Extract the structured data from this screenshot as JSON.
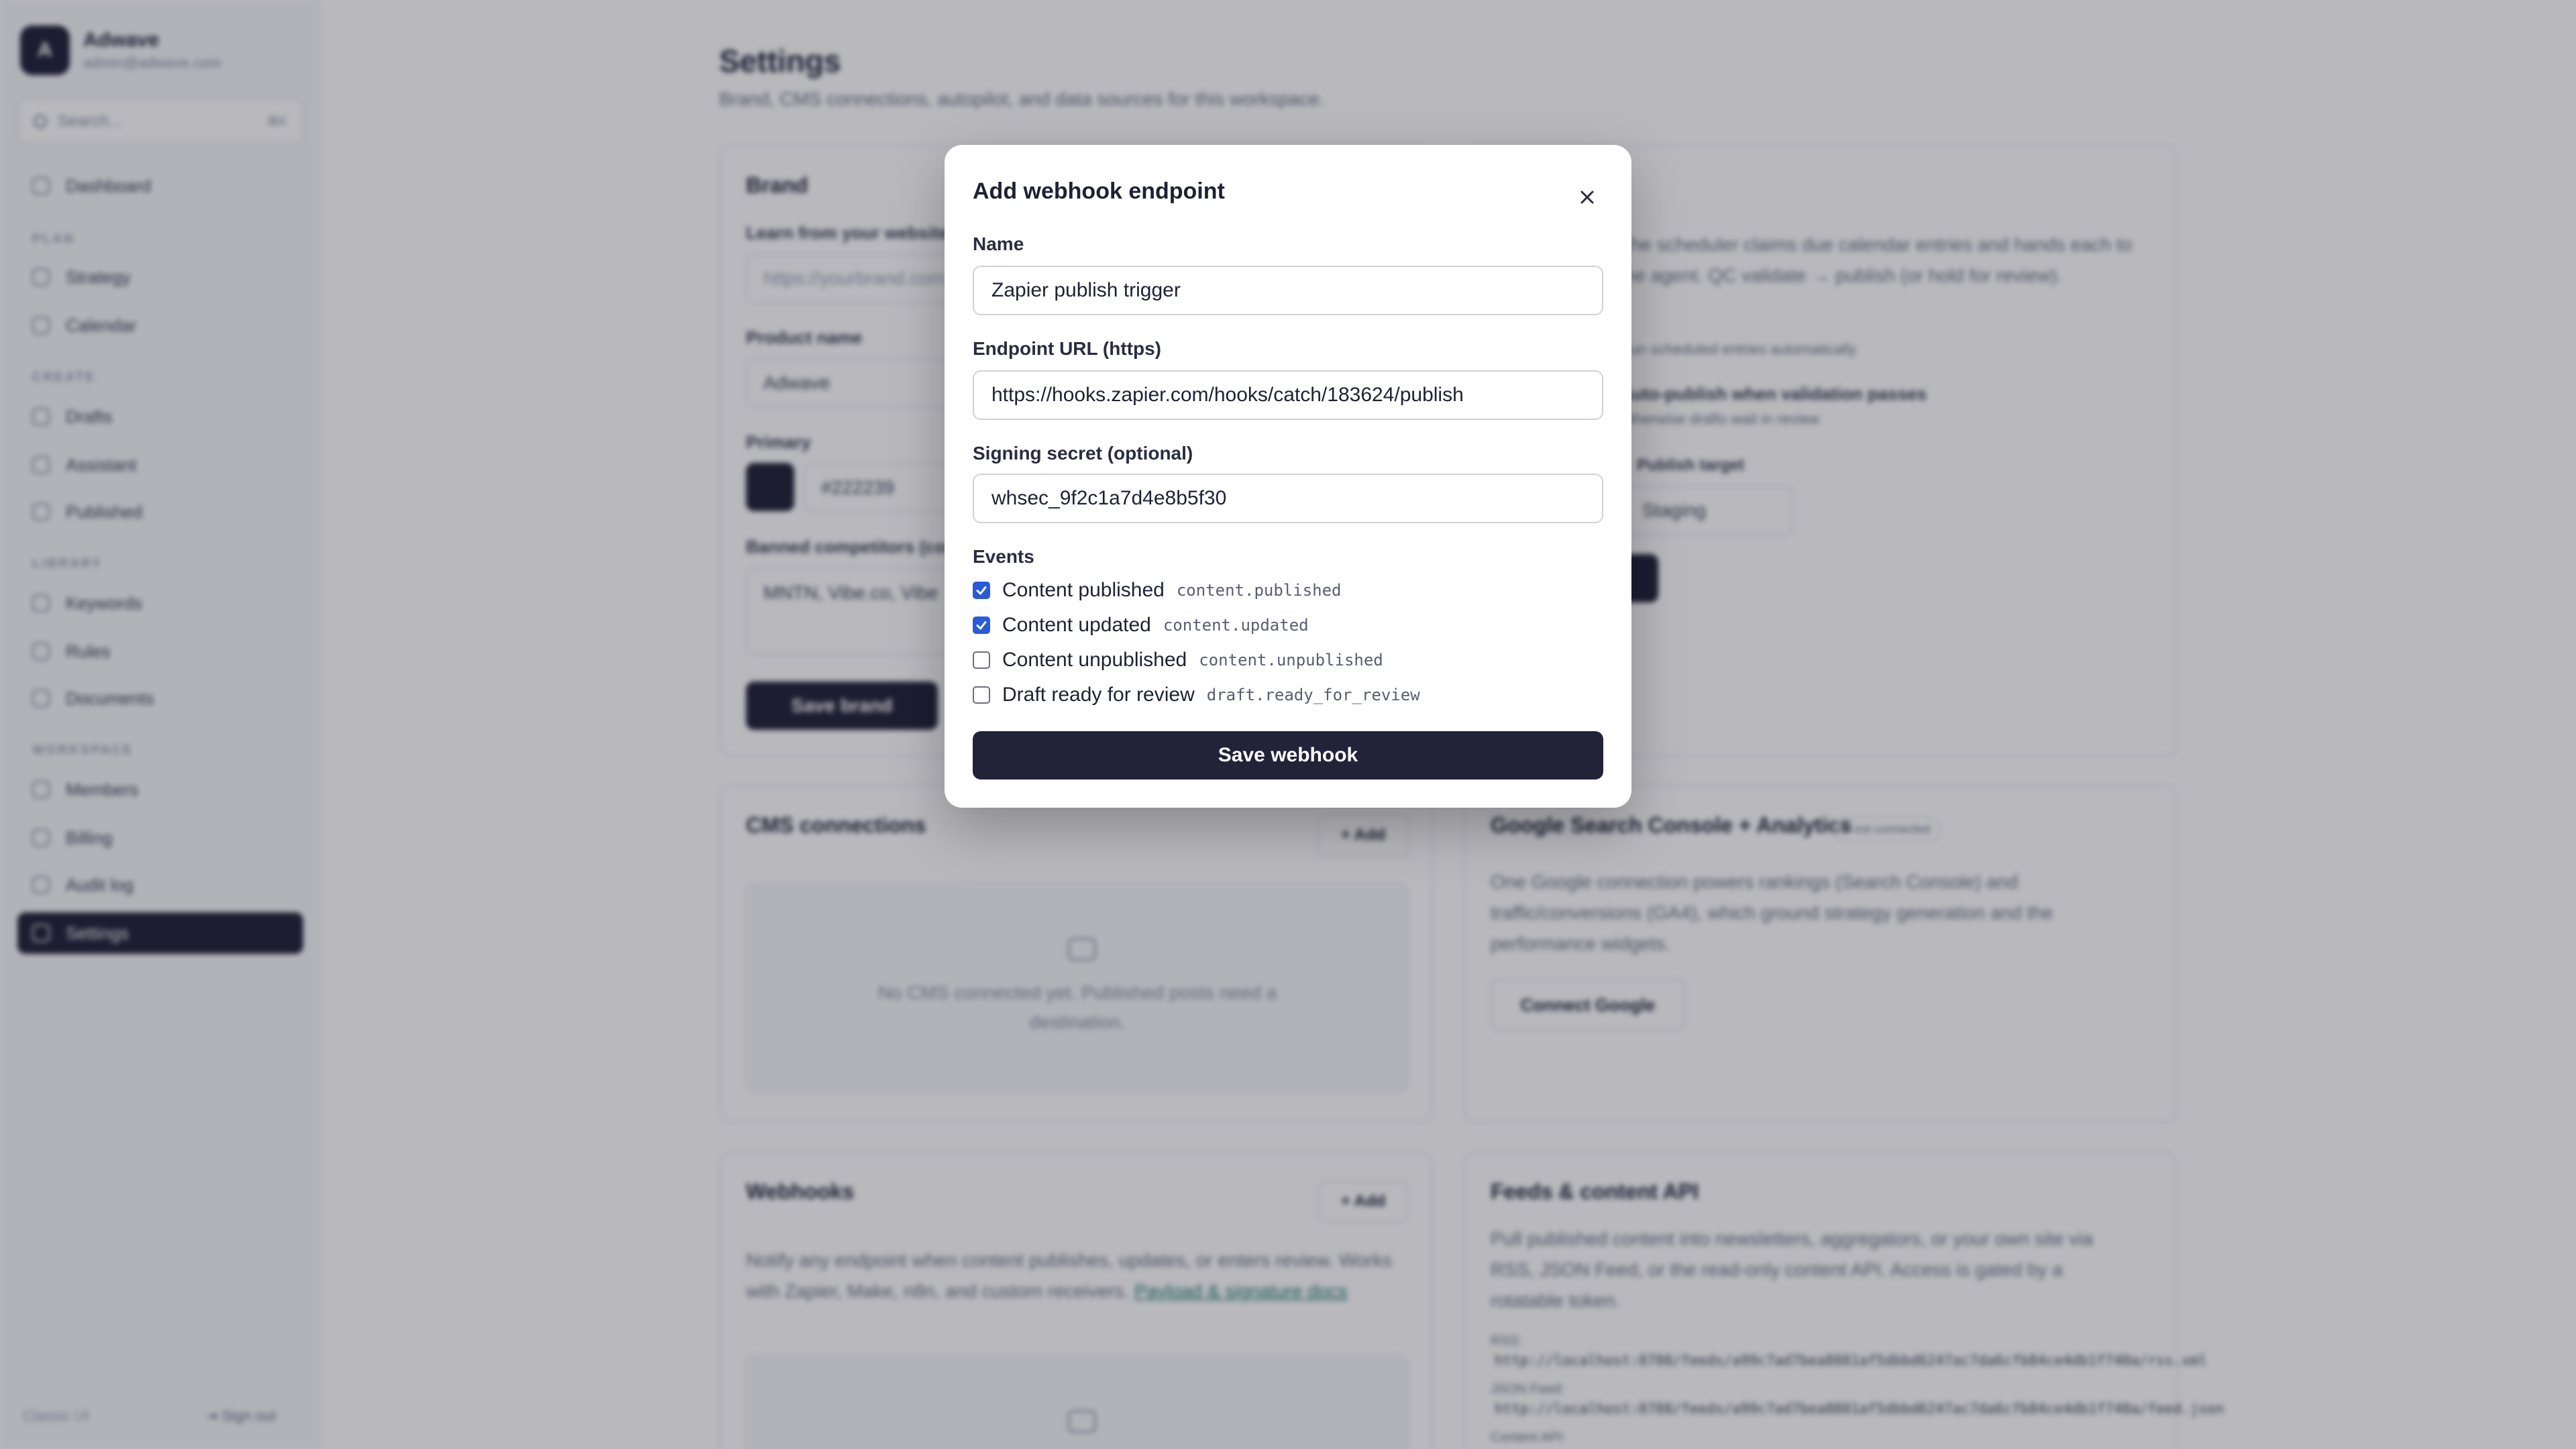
{
  "sidebar": {
    "workspace_initial": "A",
    "workspace_name": "Adwave",
    "workspace_email": "admin@adwave.com",
    "search_placeholder": "Search...",
    "search_shortcut": "⌘K",
    "items": [
      {
        "label": "Dashboard"
      },
      {
        "label": "Strategy"
      },
      {
        "label": "Calendar"
      },
      {
        "label": "Drafts"
      },
      {
        "label": "Assistant"
      },
      {
        "label": "Published"
      },
      {
        "label": "Keywords"
      },
      {
        "label": "Rules"
      },
      {
        "label": "Documents"
      },
      {
        "label": "Members"
      },
      {
        "label": "Billing"
      },
      {
        "label": "Audit log"
      },
      {
        "label": "Settings"
      }
    ],
    "sections": [
      "PLAN",
      "CREATE",
      "LIBRARY",
      "WORKSPACE"
    ],
    "footer_left": "Classic UI",
    "footer_right": "Sign out"
  },
  "page": {
    "title": "Settings",
    "subtitle": "Brand, CMS connections, autopilot, and data sources for this workspace."
  },
  "brand_card": {
    "title": "Brand",
    "learn_label": "Learn from your website",
    "url_placeholder": "https://yourbrand.com",
    "product_label": "Product name",
    "product_value": "Adwave",
    "primary_label": "Primary",
    "primary_value": "#222239",
    "banned_label": "Banned competitors (comma-separated)",
    "banned_value": "MNTN, Vibe.co, Vibe",
    "save_label": "Save brand"
  },
  "autopilot_card": {
    "desc": "The scheduler claims due calendar entries and hands each to the agent. QC validate → publish (or hold for review).",
    "toggle1": "Run scheduled entries automatically",
    "toggle2": "Auto-publish when validation passes",
    "toggle2_sub": "Otherwise drafts wait in review",
    "target_label": "Publish target",
    "target_value": "Staging"
  },
  "cms_card": {
    "title": "CMS connections",
    "add_label": "+ Add",
    "empty_text": "No CMS connected yet. Published posts need a destination."
  },
  "google_card": {
    "title": "Google Search Console + Analytics",
    "badge": "● not connected",
    "desc": "One Google connection powers rankings (Search Console) and traffic/conversions (GA4), which ground strategy generation and the performance widgets.",
    "button": "Connect Google"
  },
  "webhooks_card": {
    "title": "Webhooks",
    "add_label": "+ Add",
    "desc": "Notify any endpoint when content publishes, updates, or enters review. Works with Zapier, Make, n8n, and custom receivers.",
    "docs_link": "Payload & signature docs"
  },
  "feeds_card": {
    "title": "Feeds & content API",
    "desc": "Pull published content into newsletters, aggregators, or your own site via RSS, JSON Feed, or the read-only content API. Access is gated by a rotatable token.",
    "rss_label": "RSS:",
    "rss_url": "http://localhost:8788/feeds/a99c7ad7bea8881af5dbbd6247ac7da6cfb84ce4db1f740a/rss.xml",
    "json_label": "JSON Feed:",
    "json_url": "http://localhost:8788/feeds/a99c7ad7bea8881af5dbbd6247ac7da6cfb84ce4db1f740a/feed.json",
    "api_label": "Content API:"
  },
  "modal": {
    "title": "Add webhook endpoint",
    "name_label": "Name",
    "name_value": "Zapier publish trigger",
    "url_label": "Endpoint URL (https)",
    "url_value": "https://hooks.zapier.com/hooks/catch/183624/publish",
    "secret_label": "Signing secret (optional)",
    "secret_value": "whsec_9f2c1a7d4e8b5f30",
    "events_label": "Events",
    "events": [
      {
        "label": "Content published",
        "code": "content.published",
        "checked": true
      },
      {
        "label": "Content updated",
        "code": "content.updated",
        "checked": true
      },
      {
        "label": "Content unpublished",
        "code": "content.unpublished",
        "checked": false
      },
      {
        "label": "Draft ready for review",
        "code": "draft.ready_for_review",
        "checked": false
      }
    ],
    "save_label": "Save webhook"
  },
  "colors": {
    "primary": "#222239",
    "checkbox": "#2a5bd7"
  }
}
